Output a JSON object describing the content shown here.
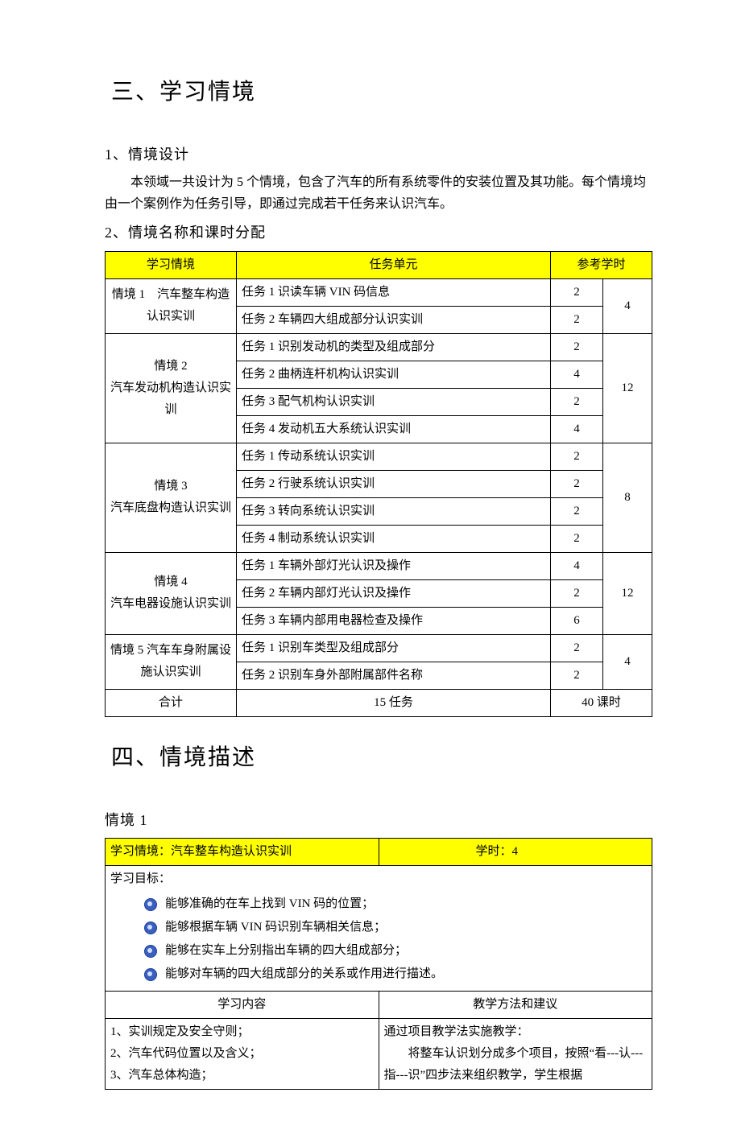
{
  "section3": {
    "heading": "三、学习情境",
    "sub1_heading": "1、情境设计",
    "sub1_para": "本领域一共设计为 5 个情境，包含了汽车的所有系统零件的安装位置及其功能。每个情境均由一个案例作为任务引导，即通过完成若干任务来认识汽车。",
    "sub2_heading": "2、情境名称和课时分配",
    "table": {
      "headers": {
        "situation": "学习情境",
        "task": "任务单元",
        "hours": "参考学时"
      },
      "rows": [
        {
          "situation": "情境 1　汽车整车构造认识实训",
          "tasks": [
            {
              "name": "任务 1 识读车辆 VIN 码信息",
              "h": "2"
            },
            {
              "name": "任务 2 车辆四大组成部分认识实训",
              "h": "2"
            }
          ],
          "total": "4"
        },
        {
          "situation": "情境 2\n汽车发动机构造认识实训",
          "tasks": [
            {
              "name": "任务 1 识别发动机的类型及组成部分",
              "h": "2"
            },
            {
              "name": "任务 2 曲柄连杆机构认识实训",
              "h": "4"
            },
            {
              "name": "任务 3 配气机构认识实训",
              "h": "2"
            },
            {
              "name": "任务 4 发动机五大系统认识实训",
              "h": "4"
            }
          ],
          "total": "12"
        },
        {
          "situation": "情境 3\n汽车底盘构造认识实训",
          "tasks": [
            {
              "name": "任务 1 传动系统认识实训",
              "h": "2"
            },
            {
              "name": "任务 2 行驶系统认识实训",
              "h": "2"
            },
            {
              "name": "任务 3 转向系统认识实训",
              "h": "2"
            },
            {
              "name": "任务 4 制动系统认识实训",
              "h": "2"
            }
          ],
          "total": "8"
        },
        {
          "situation": "情境 4\n汽车电器设施认识实训",
          "tasks": [
            {
              "name": "任务 1 车辆外部灯光认识及操作",
              "h": "4"
            },
            {
              "name": "任务 2 车辆内部灯光认识及操作",
              "h": "2"
            },
            {
              "name": "任务 3 车辆内部用电器检查及操作",
              "h": "6"
            }
          ],
          "total": "12"
        },
        {
          "situation": "情境 5 汽车车身附属设施认识实训",
          "tasks": [
            {
              "name": "任务 1 识别车类型及组成部分",
              "h": "2"
            },
            {
              "name": "任务 2 识别车身外部附属部件名称",
              "h": "2"
            }
          ],
          "total": "4"
        }
      ],
      "footer": {
        "label": "合计",
        "tasks": "15 任务",
        "hours": "40 课时"
      }
    }
  },
  "section4": {
    "heading": "四、情境描述",
    "sub_heading": "情境 1",
    "desc": {
      "header_left": "学习情境：汽车整车构造认识实训",
      "header_right": "学时：4",
      "objectives_label": "学习目标：",
      "objectives": [
        "能够准确的在车上找到 VIN 码的位置；",
        "能够根据车辆 VIN 码识别车辆相关信息；",
        "能够在实车上分别指出车辆的四大组成部分；",
        "能够对车辆的四大组成部分的关系或作用进行描述。"
      ],
      "content_label": "学习内容",
      "method_label": "教学方法和建议",
      "contents": [
        "1、实训规定及安全守则；",
        "2、汽车代码位置以及含义；",
        "3、汽车总体构造；"
      ],
      "method_lines": [
        "通过项目教学法实施教学：",
        "　　将整车认识划分成多个项目，按照“看---认---指---识”四步法来组织教学，学生根据"
      ]
    }
  }
}
